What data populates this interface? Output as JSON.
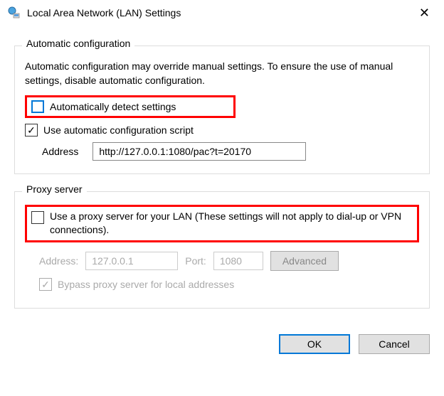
{
  "titlebar": {
    "title": "Local Area Network (LAN) Settings"
  },
  "autoConfig": {
    "legend": "Automatic configuration",
    "description": "Automatic configuration may override manual settings.  To ensure the use of manual settings, disable automatic configuration.",
    "autoDetect": {
      "label": "Automatically detect settings",
      "checked": false
    },
    "useScript": {
      "label": "Use automatic configuration script",
      "checked": true
    },
    "addressLabel": "Address",
    "addressValue": "http://127.0.0.1:1080/pac?t=20170"
  },
  "proxy": {
    "legend": "Proxy server",
    "useProxy": {
      "label": "Use a proxy server for your LAN (These settings will not apply to dial-up or VPN connections).",
      "checked": false
    },
    "addressLabel": "Address:",
    "addressValue": "127.0.0.1",
    "portLabel": "Port:",
    "portValue": "1080",
    "advancedLabel": "Advanced",
    "bypass": {
      "label": "Bypass proxy server for local addresses",
      "checked": true
    }
  },
  "footer": {
    "ok": "OK",
    "cancel": "Cancel"
  }
}
